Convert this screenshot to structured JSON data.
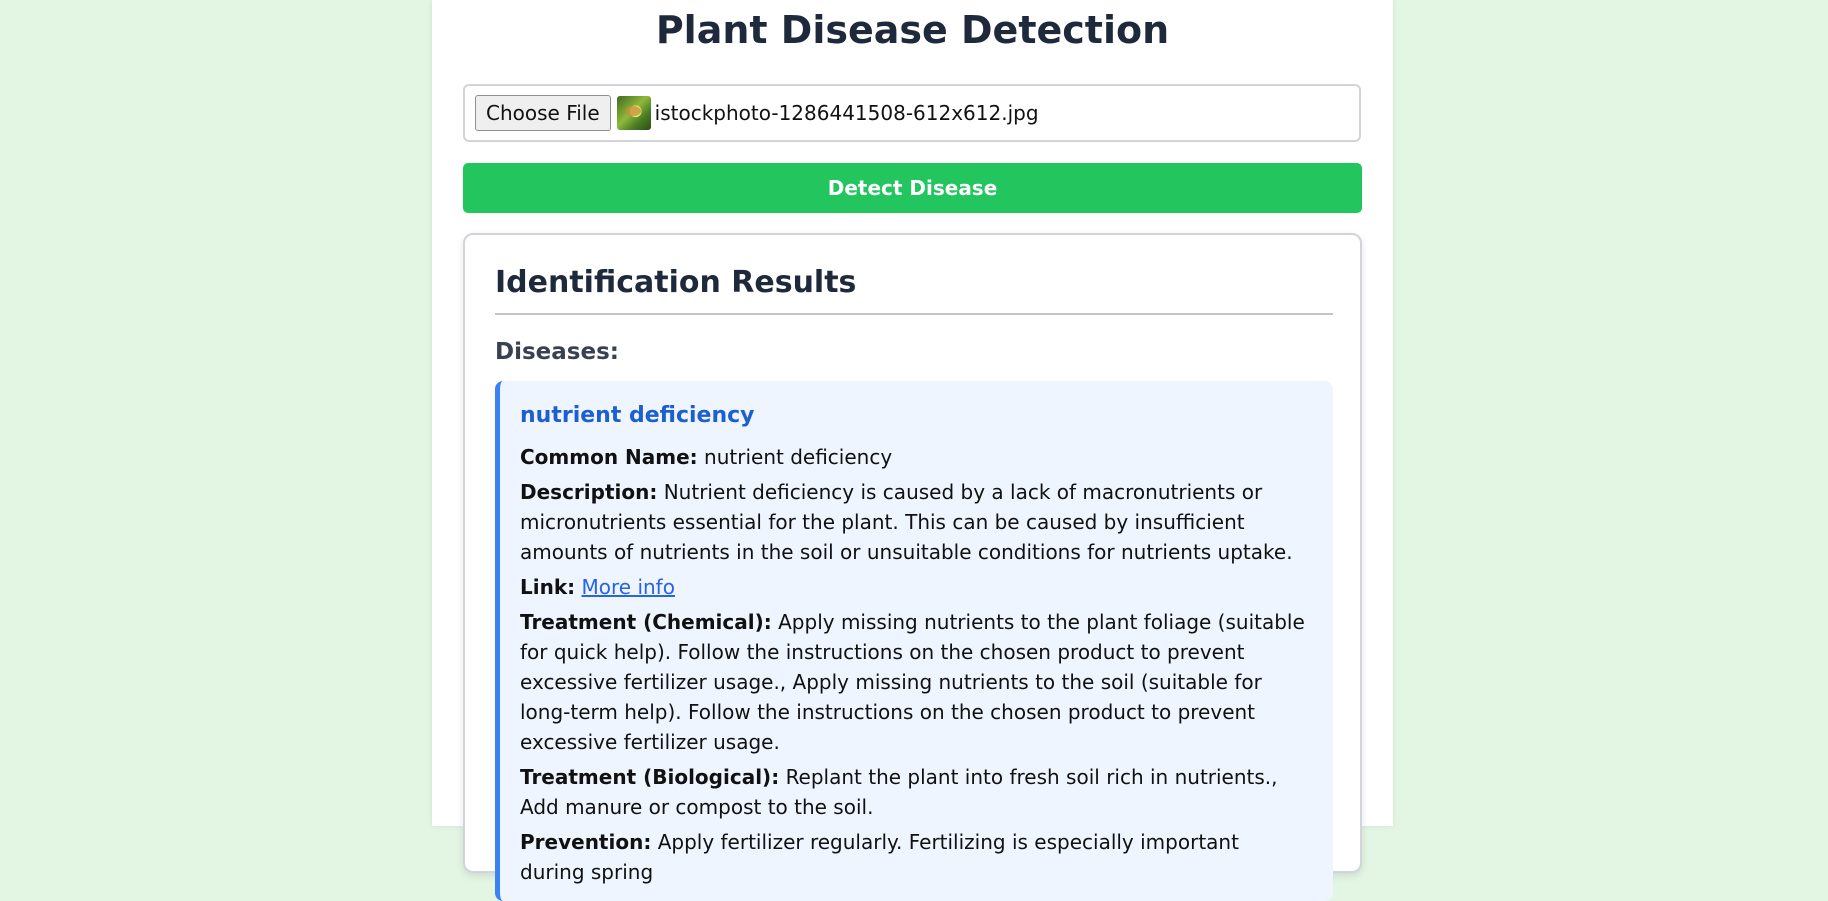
{
  "page": {
    "title": "Plant Disease Detection"
  },
  "upload": {
    "choose_label": "Choose File",
    "file_name": "istockphoto-1286441508-612x612.jpg",
    "detect_label": "Detect Disease"
  },
  "results": {
    "heading": "Identification Results",
    "diseases_heading": "Diseases:",
    "disease": {
      "name": "nutrient deficiency",
      "common_name_label": "Common Name:",
      "common_name": "nutrient deficiency",
      "description_label": "Description:",
      "description": "Nutrient deficiency is caused by a lack of macronutrients or micronutrients essential for the plant. This can be caused by insufficient amounts of nutrients in the soil or unsuitable conditions for nutrients uptake.",
      "link_label": "Link:",
      "link_text": "More info",
      "treatment_chemical_label": "Treatment (Chemical):",
      "treatment_chemical": "Apply missing nutrients to the plant foliage (suitable for quick help). Follow the instructions on the chosen product to prevent excessive fertilizer usage., Apply missing nutrients to the soil (suitable for long-term help). Follow the instructions on the chosen product to prevent excessive fertilizer usage.",
      "treatment_biological_label": "Treatment (Biological):",
      "treatment_biological": "Replant the plant into fresh soil rich in nutrients., Add manure or compost to the soil.",
      "prevention_label": "Prevention:",
      "prevention": "Apply fertilizer regularly. Fertilizing is especially important during spring"
    }
  },
  "colors": {
    "background": "#e3f5e3",
    "accent_green": "#22c55e",
    "accent_blue": "#3b82f6",
    "disease_card_bg": "#eef5ff"
  },
  "icons": {
    "file_thumbnail": "leaf-photo-thumbnail"
  }
}
